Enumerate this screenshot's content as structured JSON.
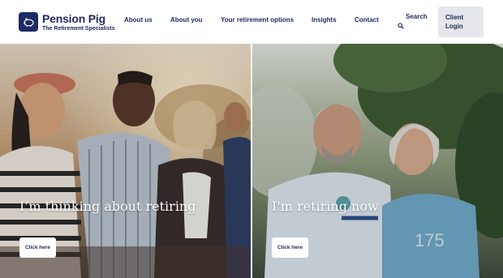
{
  "brand": {
    "name": "Pension Pig",
    "tagline": "The Retirement Specialists",
    "logo_icon": "pig-icon",
    "color": "#1e2a63"
  },
  "nav": {
    "items": [
      {
        "label": "About us"
      },
      {
        "label": "About you"
      },
      {
        "label": "Your retirement options"
      },
      {
        "label": "Insights"
      },
      {
        "label": "Contact"
      }
    ],
    "search_label": "Search",
    "search_icon": "search-icon",
    "login_line1": "Client",
    "login_line2": "Login"
  },
  "hero": {
    "panels": [
      {
        "title": "I’m thinking about retiring",
        "button": "Click here"
      },
      {
        "title": "I'm retiring now",
        "button": "Click here"
      }
    ]
  }
}
